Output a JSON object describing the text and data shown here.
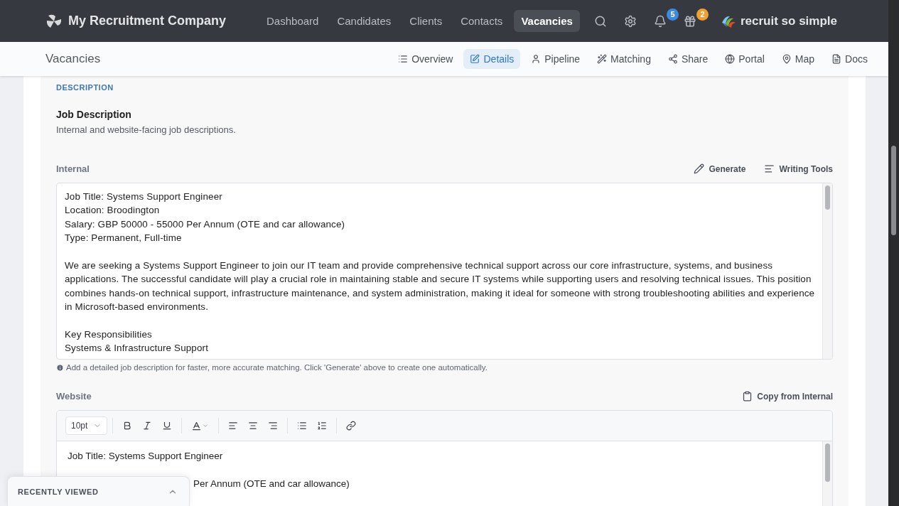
{
  "brand": {
    "name": "My Recruitment Company"
  },
  "nav": [
    {
      "label": "Dashboard",
      "selected": false
    },
    {
      "label": "Candidates",
      "selected": false
    },
    {
      "label": "Clients",
      "selected": false
    },
    {
      "label": "Contacts",
      "selected": false
    },
    {
      "label": "Vacancies",
      "selected": true
    }
  ],
  "notifications": {
    "count": "5"
  },
  "gifts": {
    "count": "2"
  },
  "partner": {
    "name": "recruit so simple"
  },
  "page_title": "Vacancies",
  "subtabs": [
    {
      "label": "Overview",
      "selected": false
    },
    {
      "label": "Details",
      "selected": true
    },
    {
      "label": "Pipeline",
      "selected": false
    },
    {
      "label": "Matching",
      "selected": false
    },
    {
      "label": "Share",
      "selected": false
    },
    {
      "label": "Portal",
      "selected": false
    },
    {
      "label": "Map",
      "selected": false
    },
    {
      "label": "Docs",
      "selected": false
    }
  ],
  "section": {
    "heading": "DESCRIPTION",
    "title": "Job Description",
    "subtitle": "Internal and website-facing job descriptions."
  },
  "internal": {
    "label": "Internal",
    "actions": [
      "Generate",
      "Writing Tools"
    ],
    "text": "Job Title: Systems Support Engineer\nLocation: Broodington\nSalary: GBP 50000 - 55000 Per Annum (OTE and car allowance)\nType: Permanent, Full-time\n\nWe are seeking a Systems Support Engineer to join our IT team and provide comprehensive technical support across our core infrastructure, systems, and business applications. The successful candidate will play a crucial role in maintaining stable and secure IT systems while supporting users and resolving technical issues. This position combines hands-on technical support, infrastructure maintenance, and system administration, making it ideal for someone with strong troubleshooting abilities and experience in Microsoft-based environments.\n\nKey Responsibilities\nSystems & Infrastructure Support",
    "hint": "Add a detailed job description for faster, more accurate matching. Click 'Generate' above to create one automatically."
  },
  "website": {
    "label": "Website",
    "action": "Copy from Internal",
    "font_size": "10pt",
    "lines": [
      "Job Title: Systems Support Engineer",
      "Per Annum (OTE and car allowance)"
    ]
  },
  "recently_viewed": {
    "title": "RECENTLY VIEWED",
    "expanded": false
  }
}
